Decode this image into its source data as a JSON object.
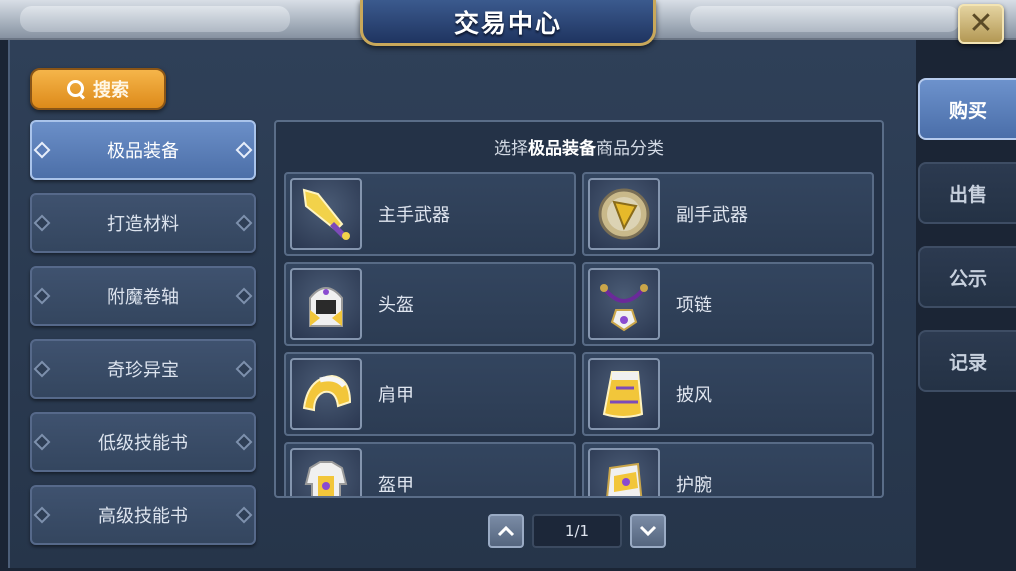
{
  "title": "交易中心",
  "search": {
    "label": "搜索"
  },
  "categories": [
    {
      "label": "极品装备",
      "active": true
    },
    {
      "label": "打造材料",
      "active": false
    },
    {
      "label": "附魔卷轴",
      "active": false
    },
    {
      "label": "奇珍异宝",
      "active": false
    },
    {
      "label": "低级技能书",
      "active": false
    },
    {
      "label": "高级技能书",
      "active": false
    }
  ],
  "grid": {
    "header_prefix": "选择",
    "header_bold": "极品装备",
    "header_suffix": "商品分类",
    "items": [
      {
        "name": "主手武器",
        "icon": "sword-icon"
      },
      {
        "name": "副手武器",
        "icon": "shield-icon"
      },
      {
        "name": "头盔",
        "icon": "helmet-icon"
      },
      {
        "name": "项链",
        "icon": "necklace-icon"
      },
      {
        "name": "肩甲",
        "icon": "pauldron-icon"
      },
      {
        "name": "披风",
        "icon": "cape-icon"
      },
      {
        "name": "盔甲",
        "icon": "armor-icon"
      },
      {
        "name": "护腕",
        "icon": "bracer-icon"
      }
    ]
  },
  "pager": {
    "page": "1/1"
  },
  "side_tabs": [
    {
      "label": "购买",
      "active": true
    },
    {
      "label": "出售",
      "active": false
    },
    {
      "label": "公示",
      "active": false
    },
    {
      "label": "记录",
      "active": false
    }
  ],
  "colors": {
    "accent_gold": "#c9a85a",
    "active_blue": "#5a7db8",
    "search_orange": "#e99a2a"
  }
}
